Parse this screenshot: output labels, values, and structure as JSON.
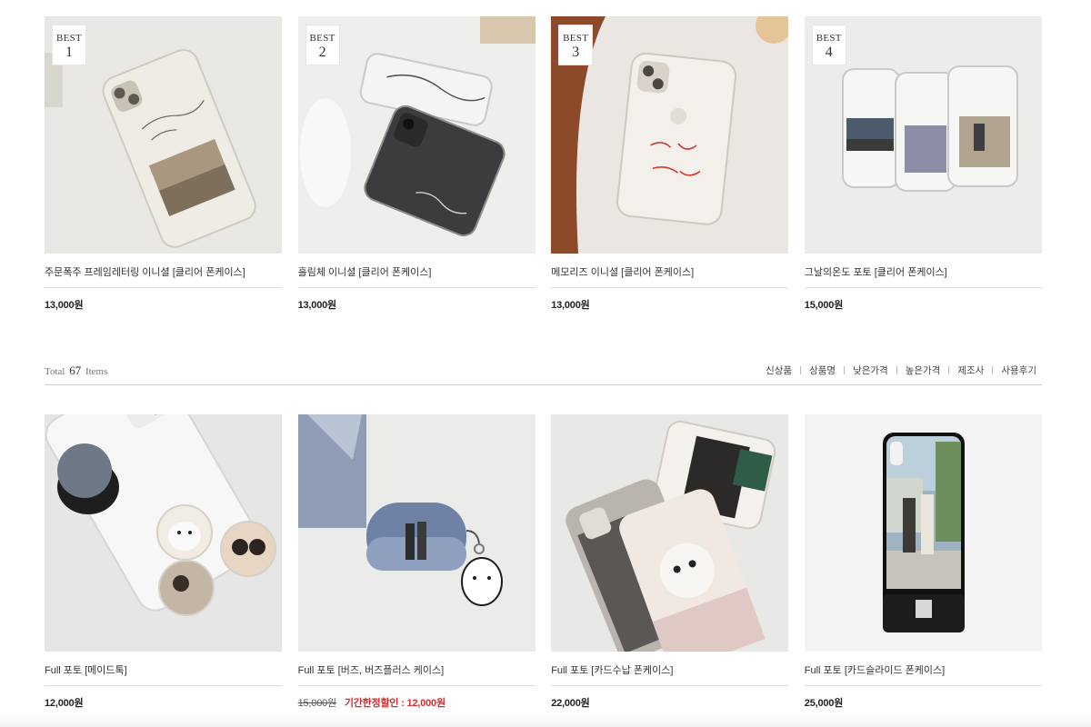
{
  "best_products": [
    {
      "best_label": "BEST",
      "rank": "1",
      "name": "주문폭주 프레임레터링 이니셜 [클리어 폰케이스]",
      "price": "13,000원"
    },
    {
      "best_label": "BEST",
      "rank": "2",
      "name": "흘림체 이니셜 [클리어 폰케이스]",
      "price": "13,000원"
    },
    {
      "best_label": "BEST",
      "rank": "3",
      "name": "메모리즈 이니셜 [클리어 폰케이스]",
      "price": "13,000원"
    },
    {
      "best_label": "BEST",
      "rank": "4",
      "name": "그날의온도 포토 [클리어 폰케이스]",
      "price": "15,000원"
    }
  ],
  "product_list": {
    "total_prefix": "Total",
    "total_count": "67",
    "total_suffix": "Items",
    "sort_options": [
      "신상품",
      "상품명",
      "낮은가격",
      "높은가격",
      "제조사",
      "사용후기"
    ]
  },
  "products": [
    {
      "name": "Full 포토 [메이드톡]",
      "price": "12,000원"
    },
    {
      "name": "Full 포토 [버즈, 버즈플러스 케이스]",
      "original_price": "15,000원",
      "sale_text": "기간한정할인 : 12,000원"
    },
    {
      "name": "Full 포토 [카드수납 폰케이스]",
      "price": "22,000원"
    },
    {
      "name": "Full 포토 [카드슬라이드 폰케이스]",
      "price": "25,000원"
    }
  ],
  "colors": {
    "sale_red": "#d62b2b",
    "divider": "#dcdcdc",
    "text": "#333333"
  }
}
